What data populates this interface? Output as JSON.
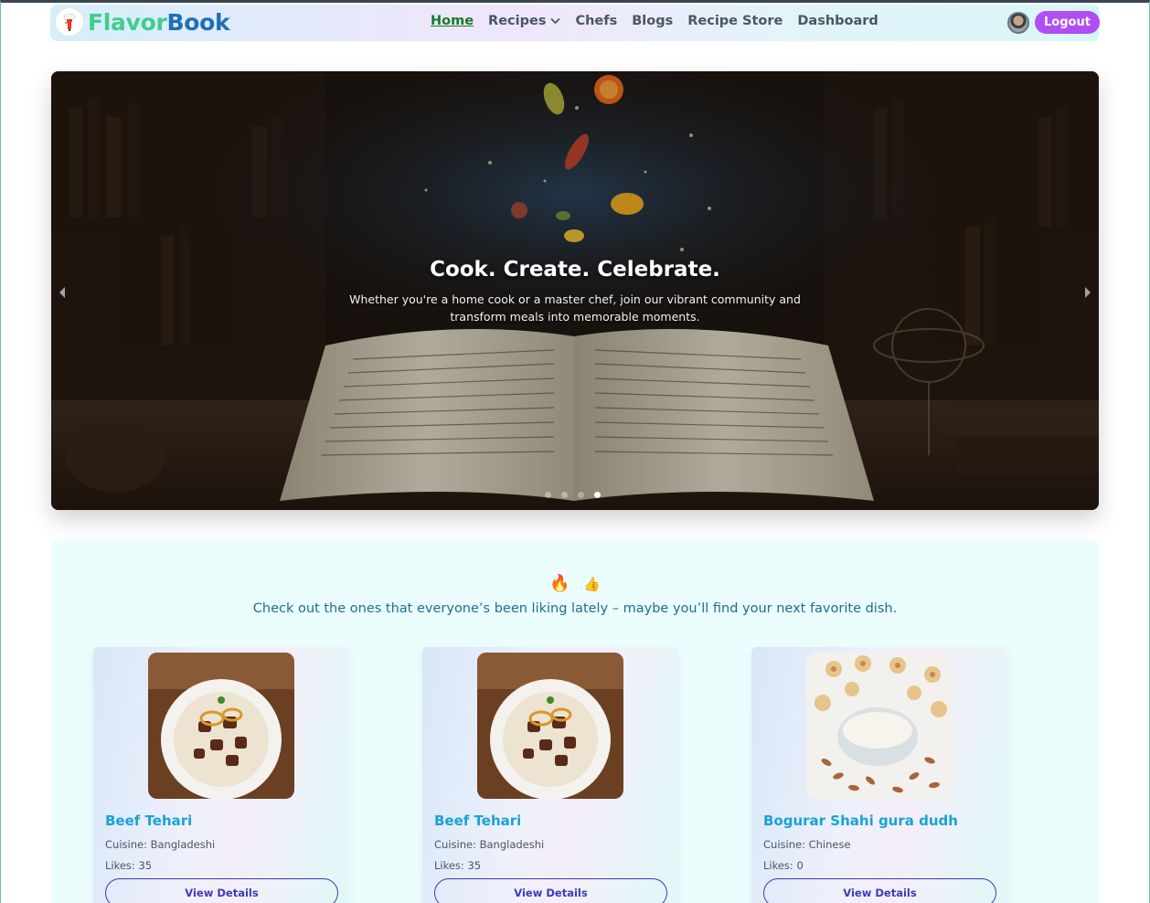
{
  "brand": {
    "part1": "Flavor",
    "part2": "Book"
  },
  "nav": {
    "links": [
      {
        "label": "Home"
      },
      {
        "label": "Recipes"
      },
      {
        "label": "Chefs"
      },
      {
        "label": "Blogs"
      },
      {
        "label": "Recipe Store"
      },
      {
        "label": "Dashboard"
      }
    ],
    "logout_label": "Logout"
  },
  "hero": {
    "title": "Cook. Create. Celebrate.",
    "subtitle": "Whether you're a home cook or a master chef, join our vibrant community and transform meals into memorable moments.",
    "slide_count": 4,
    "active_slide": 4
  },
  "popular": {
    "description": "Check out the ones that everyone’s been liking lately – maybe you’ll find your next favorite dish.",
    "cards": [
      {
        "title": "Beef Tehari",
        "cuisine": "Cuisine: Bangladeshi",
        "likes": "Likes: 35",
        "button": "View Details"
      },
      {
        "title": "Beef Tehari",
        "cuisine": "Cuisine: Bangladeshi",
        "likes": "Likes: 35",
        "button": "View Details"
      },
      {
        "title": "Bogurar Shahi gura dudh",
        "cuisine": "Cuisine: Chinese",
        "likes": "Likes: 0",
        "button": "View Details"
      }
    ]
  },
  "colors": {
    "brand_green": "#3ecf8e",
    "brand_blue": "#1f6fb4",
    "logout": "#b14ef2",
    "card_title": "#18a3d6",
    "button_border": "#3b3bb8"
  }
}
